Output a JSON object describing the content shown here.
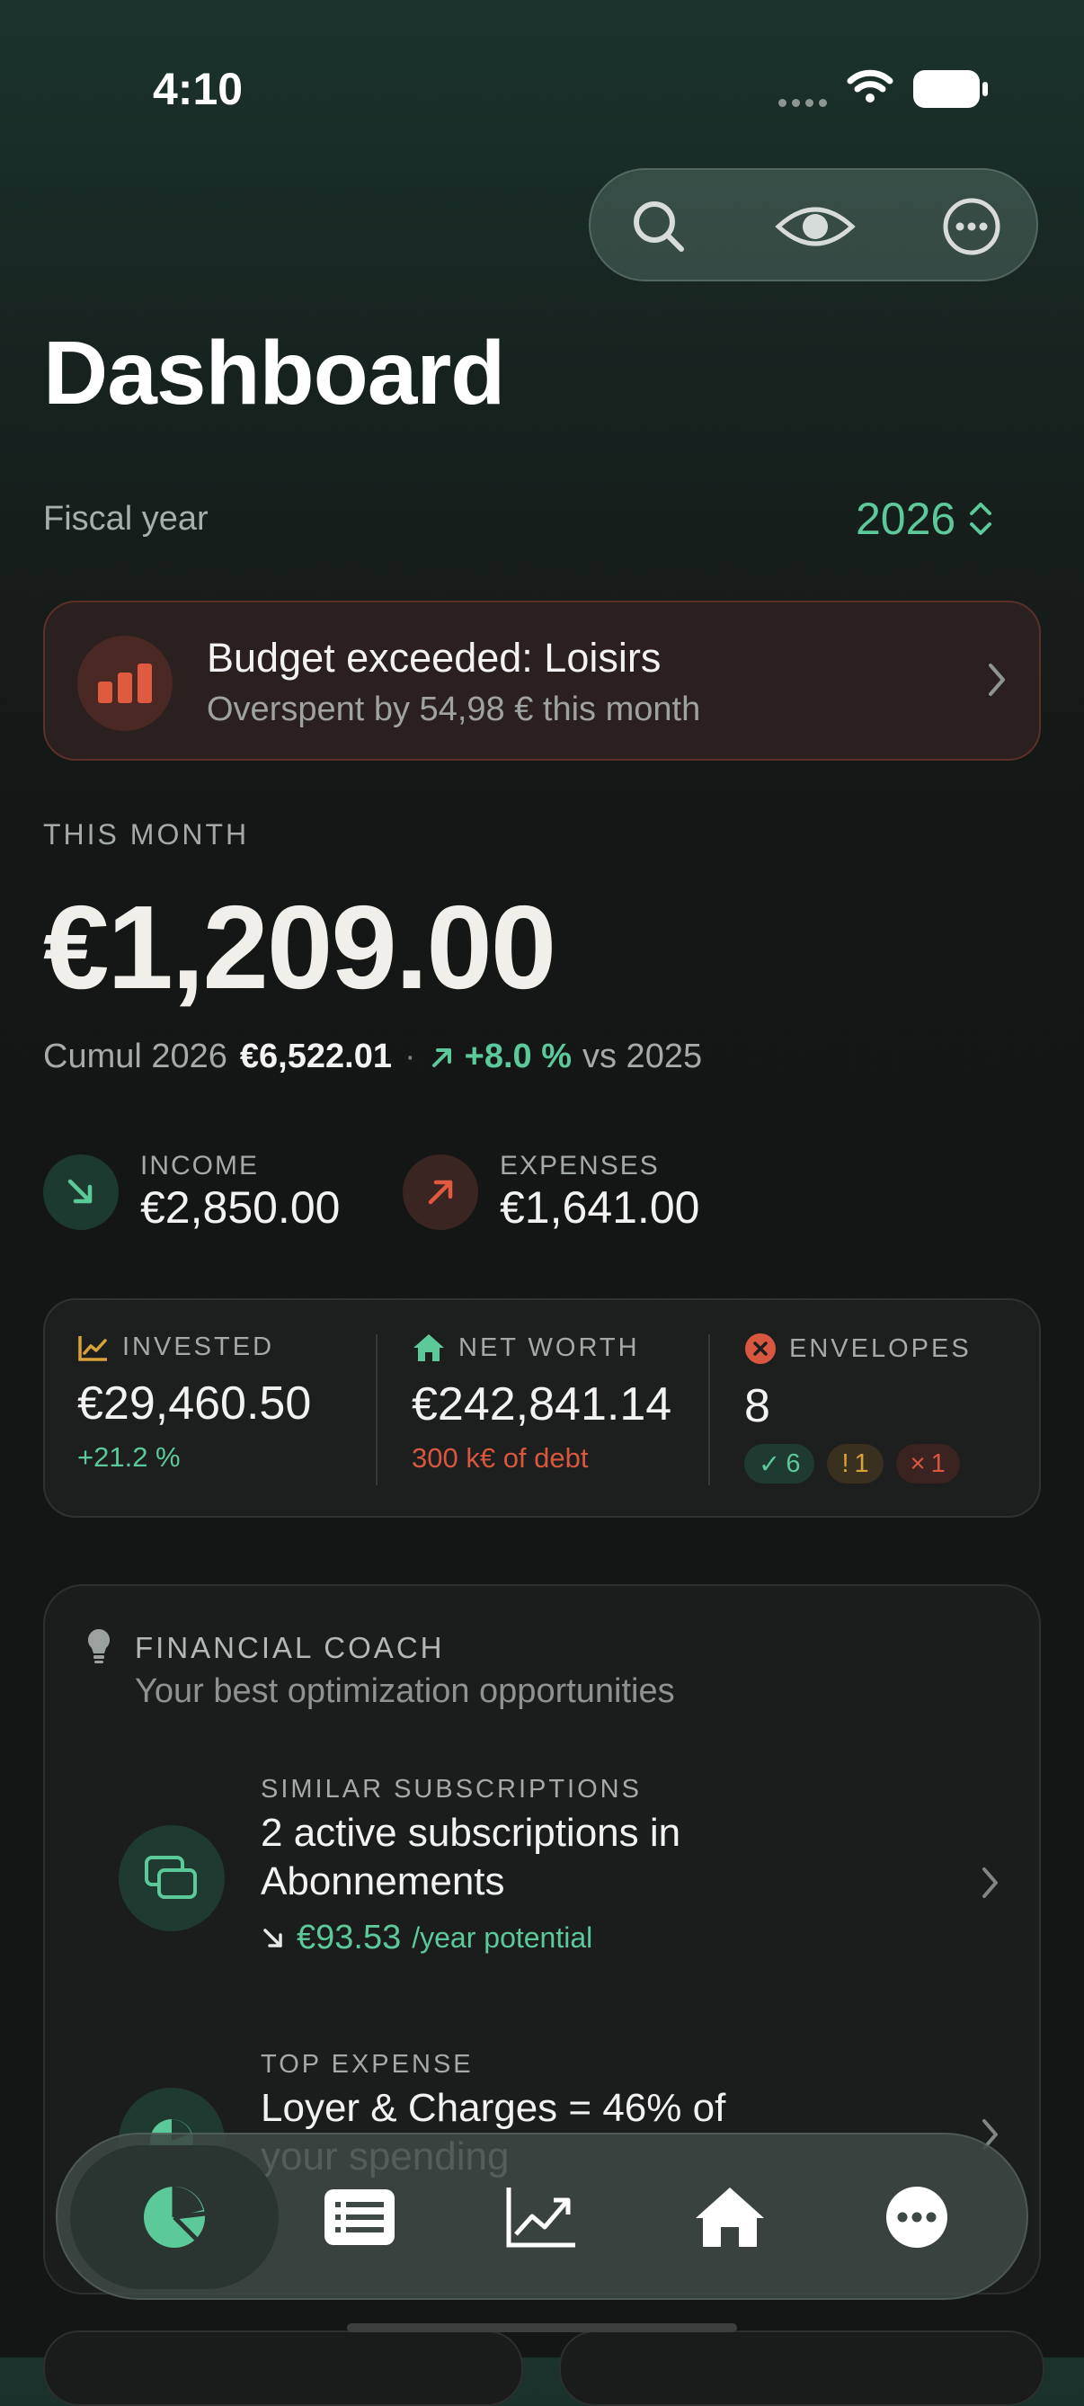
{
  "status_bar": {
    "time": "4:10"
  },
  "page": {
    "title": "Dashboard"
  },
  "fiscal_year": {
    "label": "Fiscal year",
    "value": "2026"
  },
  "alert": {
    "title": "Budget exceeded: Loisirs",
    "subtitle": "Overspent by 54,98 € this month",
    "color": "#e05a3f"
  },
  "this_month": {
    "label": "THIS MONTH",
    "amount": "€1,209.00",
    "cumul_label": "Cumul 2026",
    "cumul_value": "€6,522.01",
    "separator": "·",
    "change": "+8.0 %",
    "compare": "vs 2025"
  },
  "income": {
    "label": "INCOME",
    "value": "€2,850.00",
    "icon": "arrow-down-right-icon"
  },
  "expenses": {
    "label": "EXPENSES",
    "value": "€1,641.00",
    "icon": "arrow-up-right-icon"
  },
  "stats": {
    "invested": {
      "label": "INVESTED",
      "value": "€29,460.50",
      "sub": "+21.2 %"
    },
    "net_worth": {
      "label": "NET WORTH",
      "value": "€242,841.14",
      "sub": "300 k€ of debt"
    },
    "envelopes": {
      "label": "ENVELOPES",
      "value": "8",
      "ok_mark": "✓",
      "ok_count": "6",
      "warn_mark": "!",
      "warn_count": "1",
      "over_mark": "×",
      "over_count": "1"
    }
  },
  "coach": {
    "title": "FINANCIAL COACH",
    "subtitle": "Your best optimization opportunities",
    "items": [
      {
        "category": "SIMILAR SUBSCRIPTIONS",
        "title": "2 active subscriptions in Abonnements",
        "potential": "€93.53",
        "potential_suffix": "/year potential"
      },
      {
        "category": "TOP EXPENSE",
        "title": "Loyer & Charges = 46% of your spending"
      }
    ]
  },
  "tabs": [
    "dashboard",
    "transactions",
    "investments",
    "real-estate",
    "more"
  ],
  "colors": {
    "accent": "#5cc99a",
    "danger": "#d9573f",
    "warning": "#d9a23a"
  }
}
